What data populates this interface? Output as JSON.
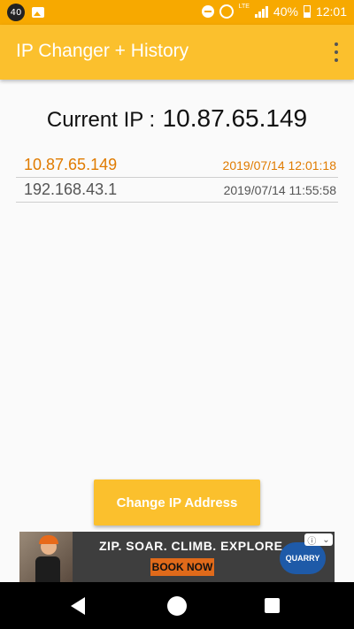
{
  "status_bar": {
    "notification_count": "40",
    "battery_percent": "40%",
    "network": "LTE",
    "time": "12:01",
    "icons": [
      "notification-badge-icon",
      "image-icon",
      "do-not-disturb-icon",
      "alarm-icon",
      "signal-icon",
      "battery-icon"
    ]
  },
  "toolbar": {
    "title": "IP Changer + History",
    "menu_icon": "overflow-menu-icon"
  },
  "current_ip": {
    "label": "Current IP :",
    "value": "10.87.65.149"
  },
  "history": [
    {
      "ip": "10.87.65.149",
      "timestamp": "2019/07/14 12:01:18",
      "active": true
    },
    {
      "ip": "192.168.43.1",
      "timestamp": "2019/07/14 11:55:58",
      "active": false
    }
  ],
  "colors": {
    "status_bar": "#f7a900",
    "toolbar": "#fbc02d",
    "active_entry": "#e07b00",
    "inactive_entry": "#555555"
  },
  "change_button": {
    "label": "Change IP Address"
  },
  "ad": {
    "headline": "ZIP. SOAR. CLIMB. EXPLORE.",
    "cta": "BOOK NOW",
    "brand": "QUARRY PARK"
  },
  "nav": {
    "icons": [
      "back-icon",
      "home-icon",
      "recent-apps-icon"
    ]
  }
}
